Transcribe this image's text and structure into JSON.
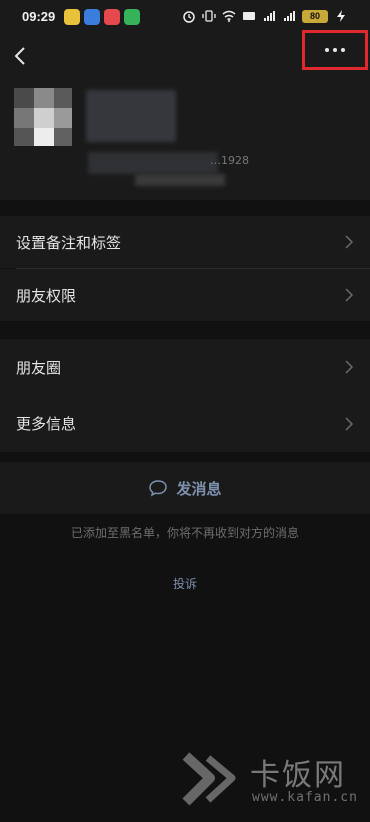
{
  "status_bar": {
    "time": "09:29",
    "battery": "80",
    "app_icon_colors": [
      "#e9c23b",
      "#3b7ddc",
      "#e5484d",
      "#35b25a"
    ]
  },
  "nav": {
    "back_icon": "chevron-left-icon",
    "more_icon": "more-dots-icon",
    "highlight_color": "#e0282f"
  },
  "profile": {
    "wechat_id_suffix": "…1928"
  },
  "settings_group_1": [
    {
      "label": "设置备注和标签"
    },
    {
      "label": "朋友权限"
    }
  ],
  "settings_group_2": [
    {
      "label": "朋友圈"
    },
    {
      "label": "更多信息"
    }
  ],
  "actions": {
    "send_message_label": "发消息",
    "send_message_icon": "chat-bubble-icon",
    "accent_color": "#7d90ad"
  },
  "notice": "已添加至黑名单，你将不再收到对方的消息",
  "report_label": "投诉",
  "watermark": {
    "brand": "卡饭网",
    "url": "www.kafan.cn"
  }
}
